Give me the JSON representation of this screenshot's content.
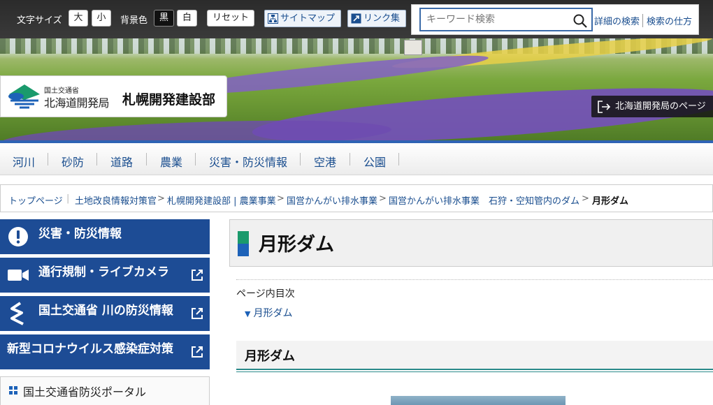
{
  "topbar": {
    "font_size_label": "文字サイズ",
    "font_large": "大",
    "font_small": "小",
    "bg_label": "背景色",
    "bg_black": "黒",
    "bg_white": "白",
    "reset": "リセット",
    "sitemap": "サイトマップ",
    "links": "リンク集",
    "search_placeholder": "キーワード検索",
    "advanced_search": "詳細の検索",
    "how_to_search": "検索の仕方"
  },
  "header": {
    "ministry": "国土交通省",
    "bureau": "北海道開発局",
    "office": "札幌開発建設部",
    "hokkaido_page": "北海道開発局のページ"
  },
  "nav": {
    "items": [
      "河川",
      "砂防",
      "道路",
      "農業",
      "災害・防災情報",
      "空港",
      "公園"
    ]
  },
  "breadcrumb": {
    "items": [
      "トップページ",
      "土地改良情報対策官",
      "札幌開発建設部 | 農業事業",
      "国営かんがい排水事業",
      "国営かんがい排水事業　石狩・空知管内のダム"
    ],
    "current": "月形ダム"
  },
  "sidebar": {
    "disaster": "災害・防災情報",
    "traffic": "通行規制・ライブカメラ",
    "river": "国土交通省 川の防災情報",
    "corona": "新型コロナウイルス感染症対策",
    "portal": "国土交通省防災ポータル"
  },
  "main": {
    "title": "月形ダム",
    "toc_label": "ページ内目次",
    "toc_items": [
      "月形ダム"
    ],
    "section_title": "月形ダム"
  },
  "colors": {
    "nav_text": "#1a4e8f",
    "sidebar_bg": "#1d4c95",
    "title_accent_green": "#1a9a6c",
    "title_accent_blue": "#1d62b8"
  }
}
